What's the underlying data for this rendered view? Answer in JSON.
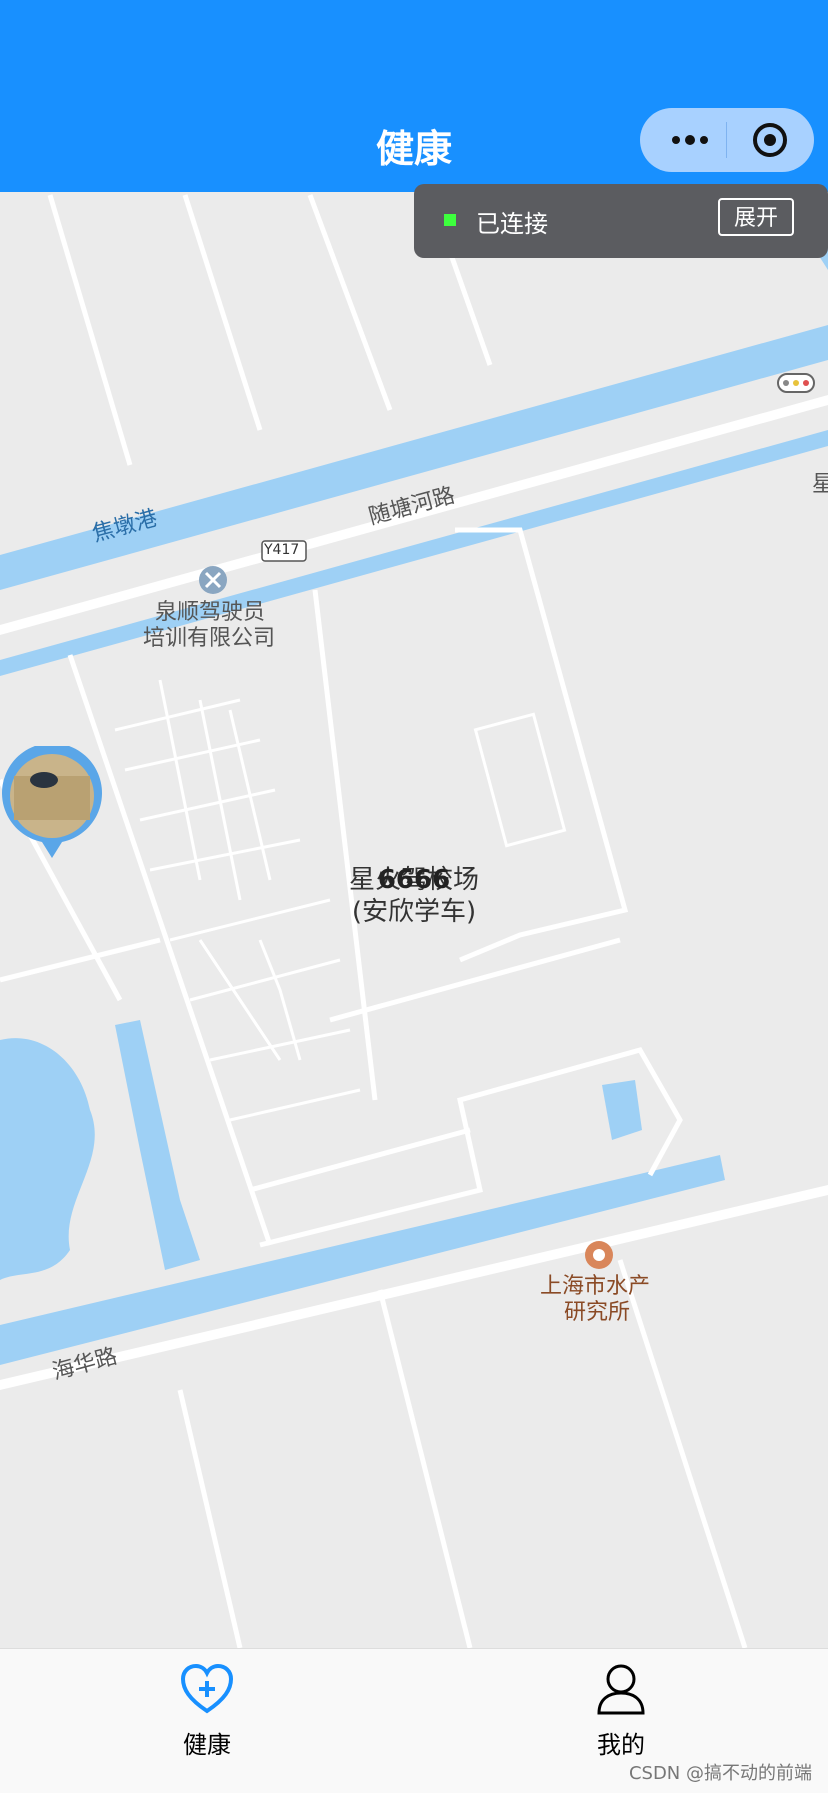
{
  "nav": {
    "title": "健康"
  },
  "status": {
    "text": "已连接",
    "expand_label": "展开",
    "indicator_color": "#3dff3d"
  },
  "map": {
    "labels": {
      "harbor": "焦墩港",
      "road1": "随塘河路",
      "road_code": "Y417",
      "poi1": "泉顺驾驶员",
      "poi1b": "培训有限公司",
      "poi2": "上海市水产",
      "poi2b": "研究所",
      "road2": "海华路",
      "edge": "星"
    },
    "marker": {
      "title": "星火驾校场",
      "overlay": "6666",
      "subtitle": "(安欣学车)"
    }
  },
  "tabs": [
    {
      "label": "健康",
      "icon": "heart-plus-icon",
      "active": true
    },
    {
      "label": "我的",
      "icon": "user-icon",
      "active": false
    }
  ],
  "watermark": "CSDN @搞不动的前端",
  "colors": {
    "nav": "#1890ff",
    "water": "#9ed0f5",
    "map_bg": "#ebebeb",
    "active_tab": "#1890ff"
  }
}
